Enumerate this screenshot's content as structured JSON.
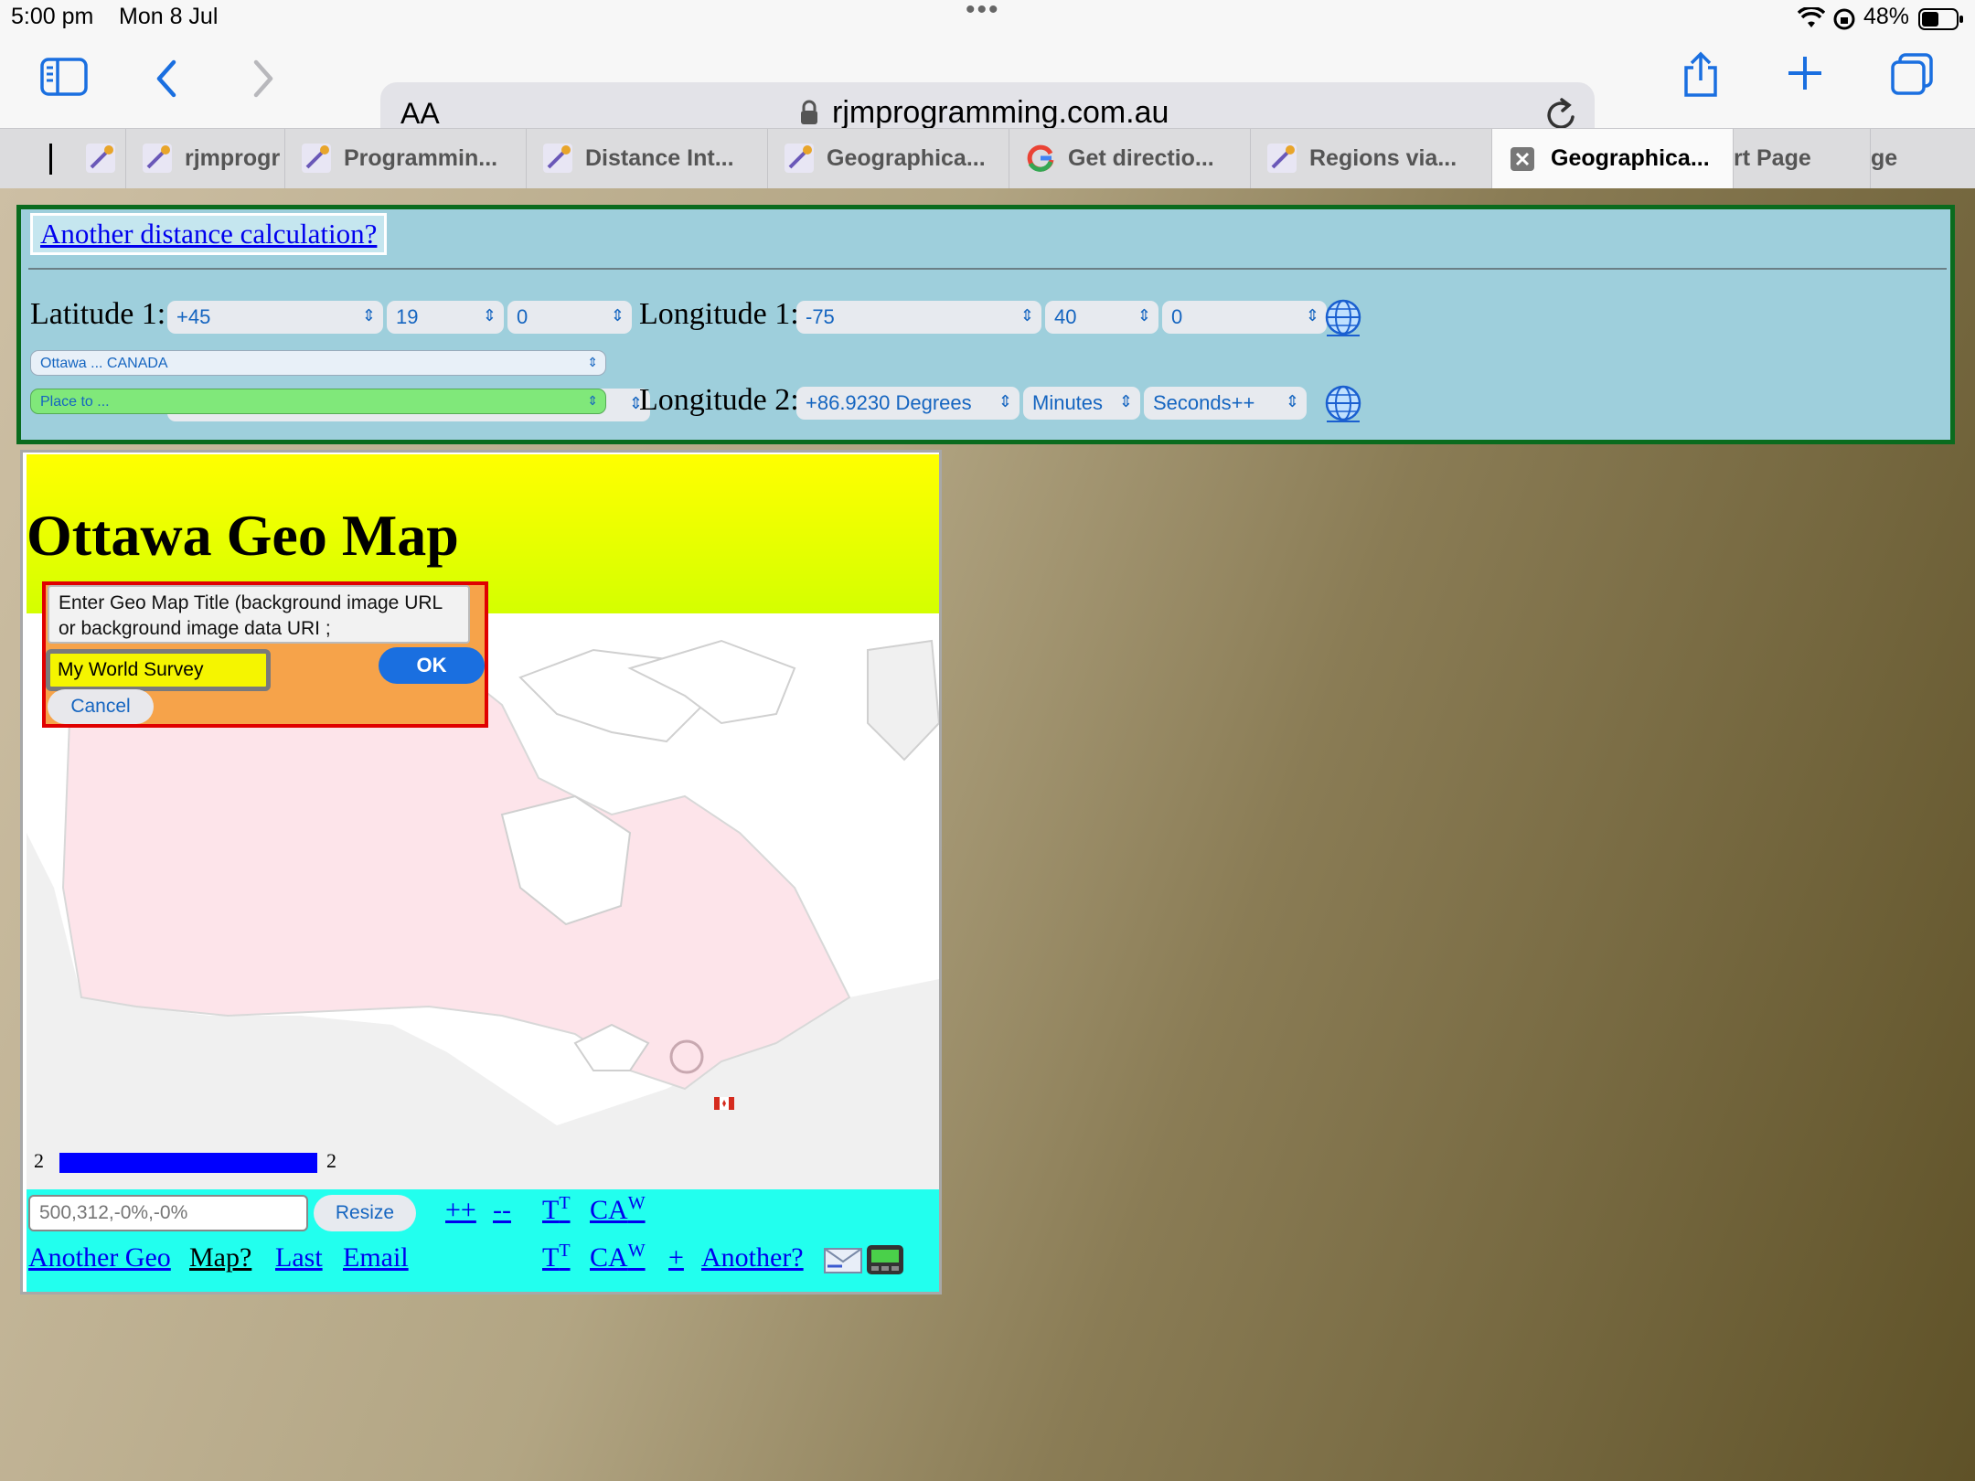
{
  "status": {
    "time": "5:00 pm",
    "date": "Mon 8 Jul",
    "battery": "48%"
  },
  "toolbar": {
    "text_size": "AA",
    "url": "rjmprogramming.com.au"
  },
  "tabs": [
    {
      "label": ""
    },
    {
      "label": "rjmprogr"
    },
    {
      "label": "Programmin..."
    },
    {
      "label": "Distance Int..."
    },
    {
      "label": "Geographica..."
    },
    {
      "label": "Get directio..."
    },
    {
      "label": "Regions via..."
    },
    {
      "label": "Geographica..."
    },
    {
      "label": "rt Page"
    },
    {
      "label": "ge"
    }
  ],
  "distance": {
    "another_link": "Another distance calculation?",
    "lat1_label": "Latitude 1:",
    "lat1_deg": "+45",
    "lat1_min": "19",
    "lat1_sec": "0",
    "lon1_label": "Longitude 1:",
    "lon1_deg": "-75",
    "lon1_min": "40",
    "lon1_sec": "0",
    "place1": "Ottawa ... CANADA",
    "place2": "Place to ...",
    "lon2_label": "Longitude 2:",
    "lon2_deg": "+86.9230 Degrees",
    "lon2_min": "Minutes",
    "lon2_sec": "Seconds++"
  },
  "map": {
    "title": "Ottawa Geo Map",
    "scale_left": "2",
    "scale_right": "2",
    "size_placeholder": "500,312,-0%,-0%",
    "resize_label": "Resize",
    "plus_link": "++",
    "minus_link": "--",
    "tt_label": "T",
    "tt_sup": "T",
    "ca_label": "CA",
    "ca_sup": "W",
    "another_geo": "Another Geo",
    "map_q": "Map?",
    "last": "Last",
    "email": "Email",
    "plus": "+",
    "another": "Another?"
  },
  "dialog": {
    "message": "Enter Geo Map Title (background image URL or background image data URI ;",
    "input_value": "My World Survey",
    "ok_label": "OK",
    "cancel_label": "Cancel"
  },
  "colors": {
    "accent": "#1a6fe0",
    "panel_border": "#0a6b1e",
    "dialog_border": "#e00000",
    "dialog_bg": "#f6a34a"
  }
}
